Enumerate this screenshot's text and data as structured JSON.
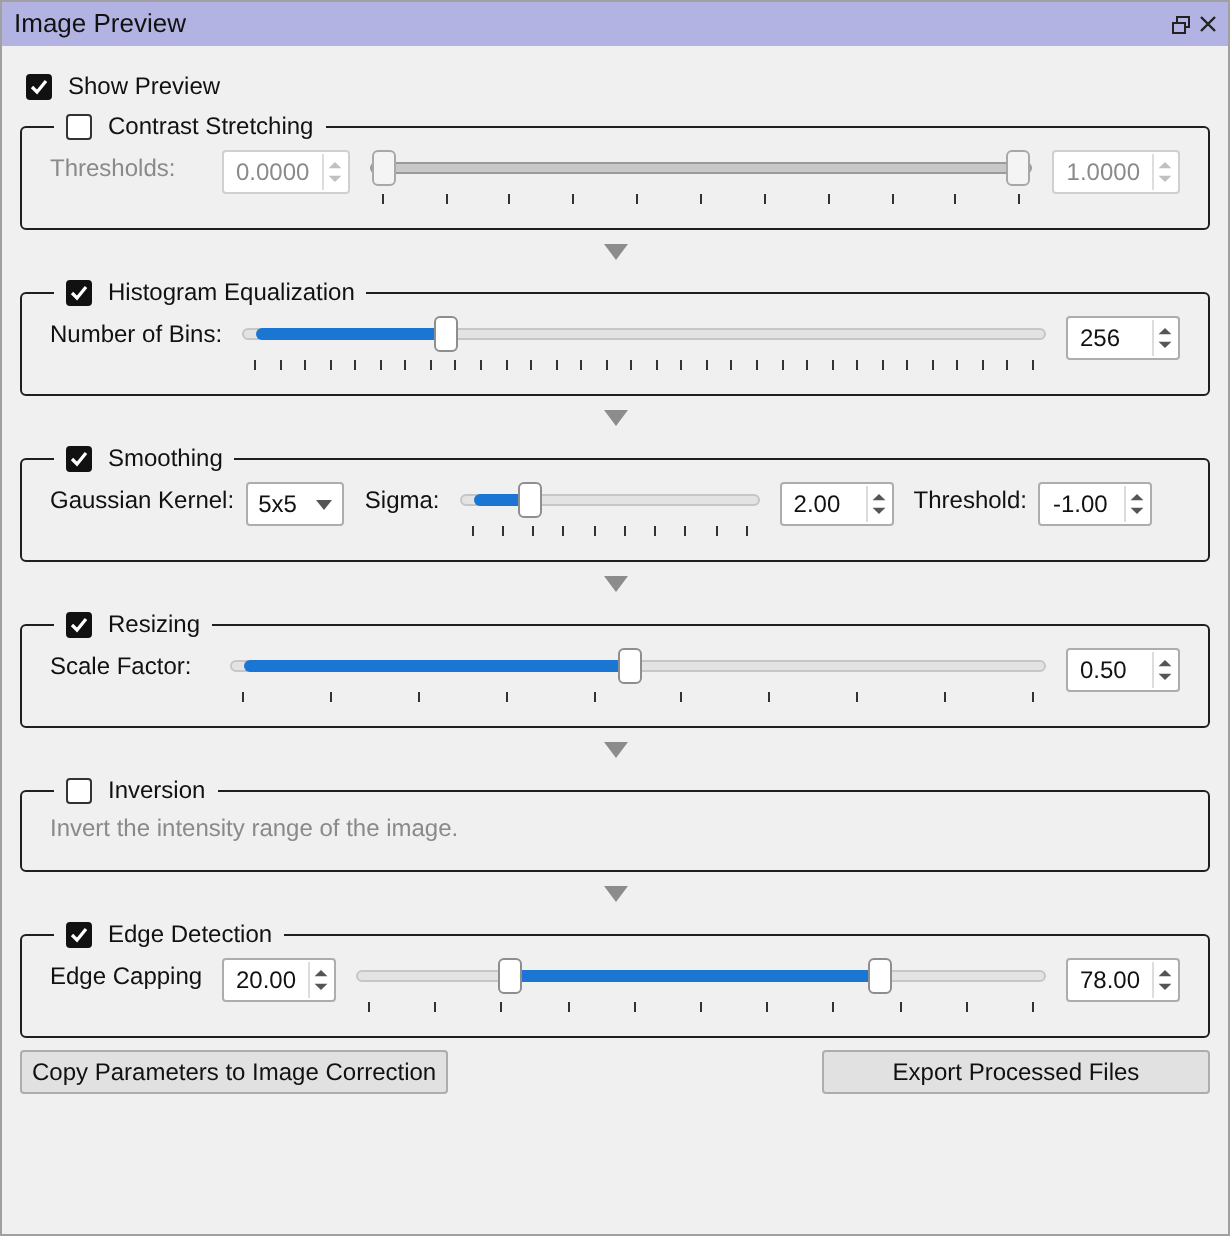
{
  "window": {
    "title": "Image Preview"
  },
  "show_preview": {
    "label": "Show Preview",
    "checked": true
  },
  "sections": [
    {
      "title": "Contrast Stretching",
      "checked": false,
      "controls": [
        {
          "kind": "label",
          "text": "Thresholds:"
        },
        {
          "kind": "spin",
          "value": "0.0000"
        },
        {
          "kind": "range",
          "thumbs": [
            {
              "level": 0
            },
            {
              "level": 1
            }
          ]
        },
        {
          "kind": "spin",
          "value": "1.0000"
        }
      ]
    },
    {
      "title": "Histogram Equalization",
      "checked": true,
      "controls": [
        {
          "kind": "label",
          "text": "Number of Bins:"
        },
        {
          "kind": "slider",
          "level": 0.245
        },
        {
          "kind": "spin",
          "value": "256"
        }
      ]
    },
    {
      "title": "Smoothing",
      "checked": true,
      "controls": [
        {
          "kind": "label",
          "text": "Gaussian Kernel:"
        },
        {
          "kind": "dropdown",
          "value": "5x5"
        },
        {
          "kind": "label",
          "text": "Sigma:"
        },
        {
          "kind": "slider",
          "level": 0.21
        },
        {
          "kind": "spin",
          "value": "2.00"
        },
        {
          "kind": "label",
          "text": "Threshold:"
        },
        {
          "kind": "spin",
          "value": "-1.00"
        }
      ]
    },
    {
      "title": "Resizing",
      "checked": true,
      "controls": [
        {
          "kind": "label",
          "text": "Scale Factor:"
        },
        {
          "kind": "slider",
          "level": 0.49
        },
        {
          "kind": "spin",
          "value": "0.50"
        }
      ]
    },
    {
      "title": "Inversion",
      "checked": false,
      "controls": [
        {
          "kind": "description",
          "text": "Invert the intensity range of the image."
        }
      ]
    },
    {
      "title": "Edge Detection",
      "checked": true,
      "controls": [
        {
          "kind": "label",
          "text": "Edge Capping"
        },
        {
          "kind": "spin",
          "value": "20.00"
        },
        {
          "kind": "range",
          "thumbs": [
            {
              "level": 0.21
            },
            {
              "level": 0.77
            }
          ]
        },
        {
          "kind": "spin",
          "value": "78.00"
        }
      ]
    }
  ],
  "buttons": [
    {
      "label": "Copy Parameters to Image Correction"
    },
    {
      "label": "Export Processed Files"
    }
  ]
}
